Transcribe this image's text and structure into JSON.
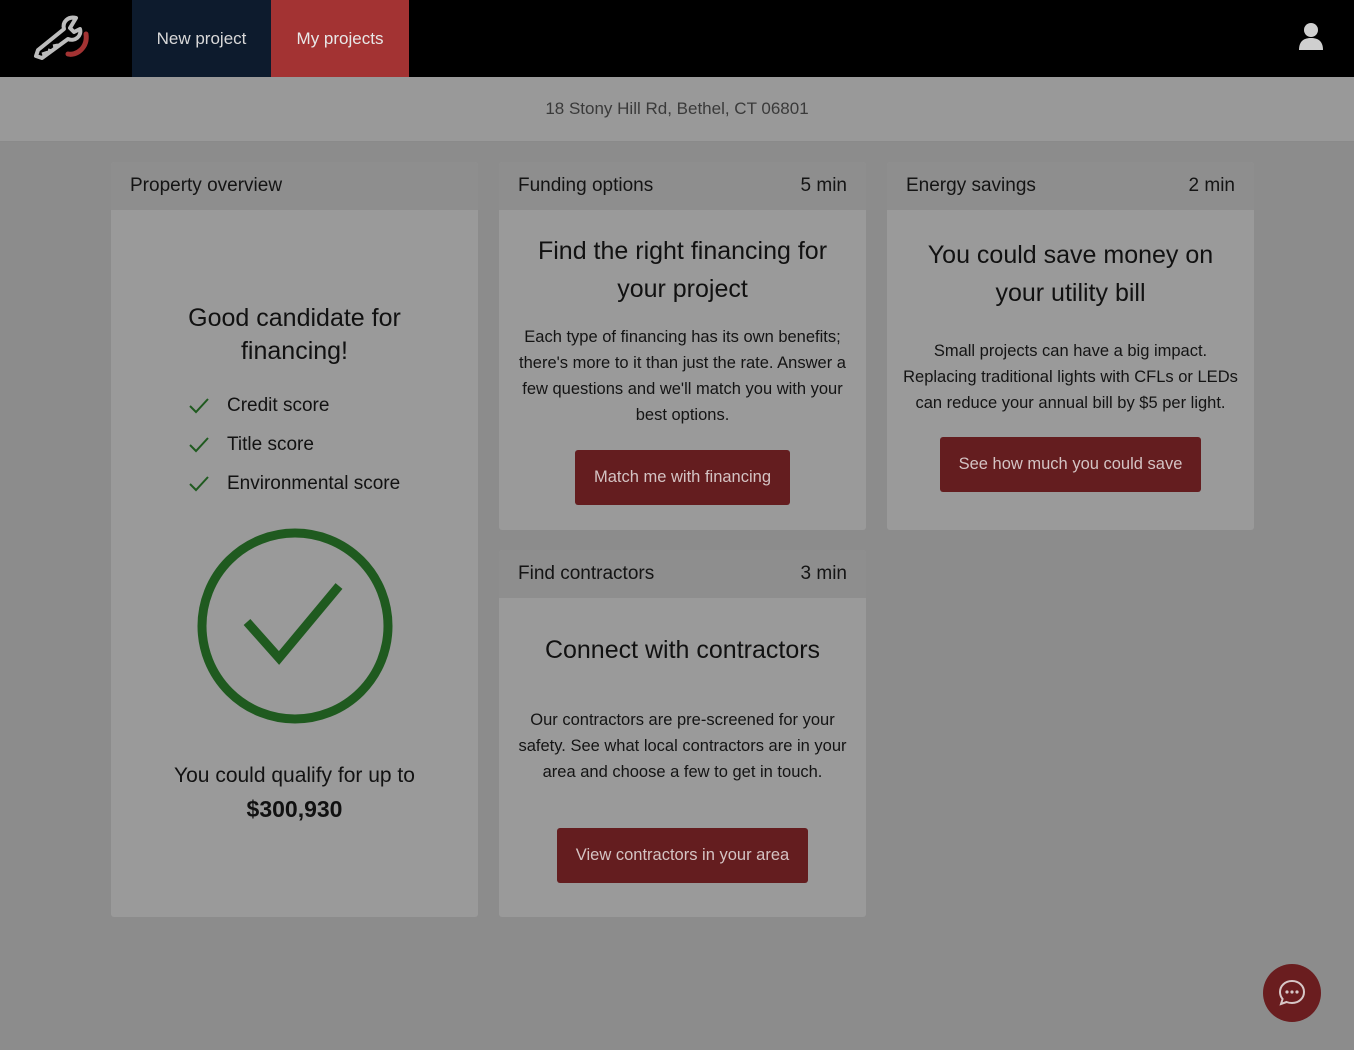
{
  "nav": {
    "logo": "wrench-logo",
    "tabs": [
      {
        "label": "New project"
      },
      {
        "label": "My projects"
      }
    ],
    "user_icon": "user-icon"
  },
  "address": "18 Stony Hill Rd, Bethel, CT 06801",
  "cards": {
    "property": {
      "title": "Property overview",
      "headline": "Good candidate for financing!",
      "checks": [
        "Credit score",
        "Title score",
        "Environmental score"
      ],
      "qualify_text": "You could qualify for up to",
      "qualify_amount": "$300,930"
    },
    "funding": {
      "title": "Funding options",
      "time": "5 min",
      "headline": "Find the right financing for your project",
      "text": "Each type of financing has its own benefits; there's more to it than just the rate. Answer a few questions and we'll match you with your best options.",
      "button": "Match me with financing"
    },
    "energy": {
      "title": "Energy savings",
      "time": "2 min",
      "headline": "You could save money on your utility bill",
      "text": "Small projects can have a big impact. Replacing traditional lights with CFLs or LEDs can reduce your annual bill by $5 per light.",
      "button": "See how much you could save"
    },
    "contractors": {
      "title": "Find contractors",
      "time": "3 min",
      "headline": "Connect with contractors",
      "text": "Our contractors are pre-screened for your safety. See what local contractors are in your area and choose a few to get in touch.",
      "button": "View contractors in your area"
    }
  },
  "colors": {
    "accent_red": "#a33333",
    "button_red": "#641d1f",
    "nav_blue": "#0d1b2d",
    "success_green": "#1f5a1f"
  },
  "chat_icon": "chat-bubble-icon"
}
